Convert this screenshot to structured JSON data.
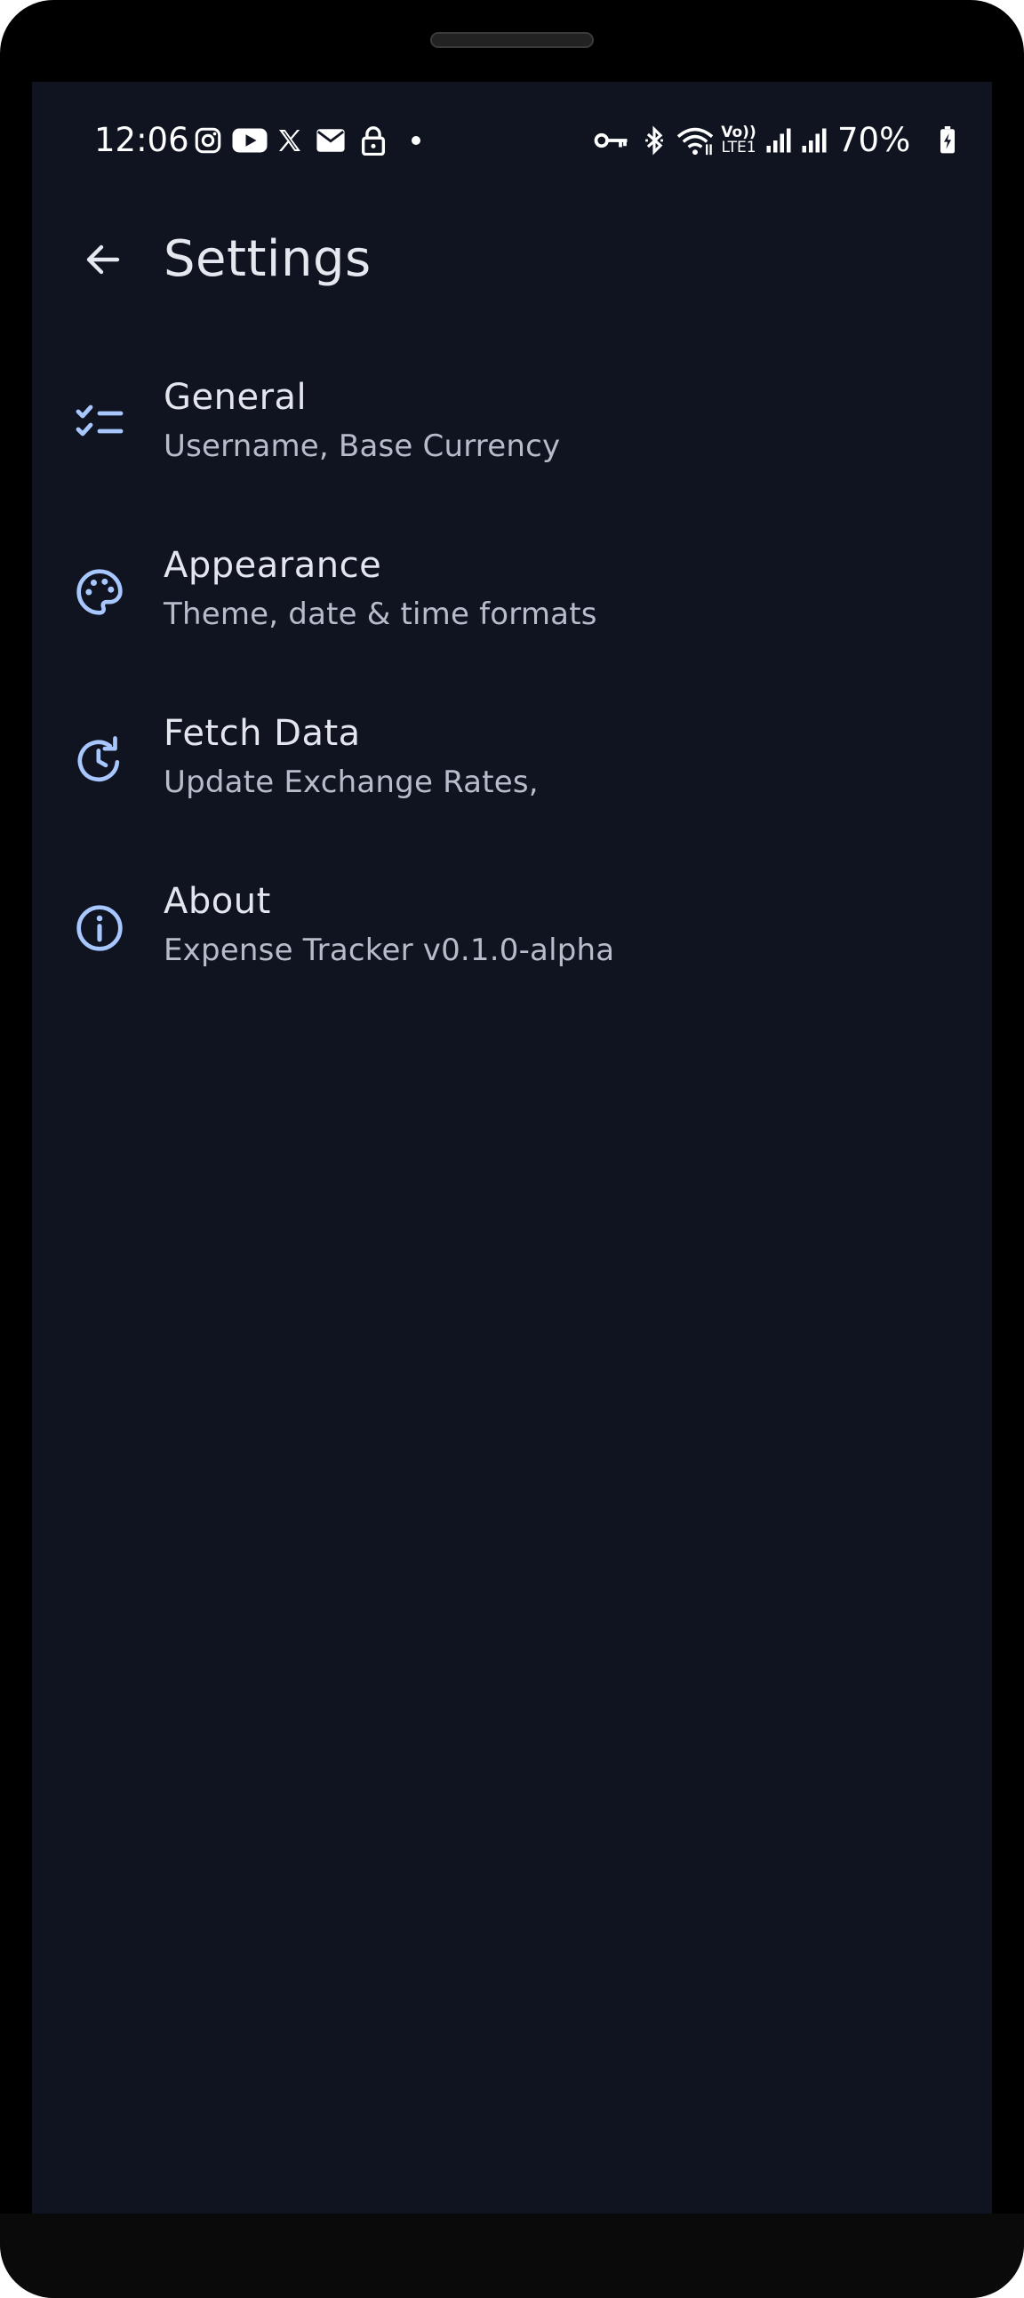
{
  "status_bar": {
    "time": "12:06",
    "notification_icons": [
      "instagram-icon",
      "youtube-icon",
      "x-icon",
      "mail-icon",
      "lock-icon"
    ],
    "system_icons": [
      "vpn-key-icon",
      "bluetooth-icon",
      "wifi-icon",
      "volte-lte1-icon",
      "signal-icon",
      "signal-icon"
    ],
    "volte_label": "Vo))",
    "lte_label": "LTE1",
    "battery_percent": "70%"
  },
  "appbar": {
    "title": "Settings"
  },
  "settings": {
    "items": [
      {
        "title": "General",
        "subtitle": "Username, Base Currency",
        "icon": "checklist-icon"
      },
      {
        "title": "Appearance",
        "subtitle": "Theme, date & time formats",
        "icon": "palette-icon"
      },
      {
        "title": "Fetch Data",
        "subtitle": "Update Exchange Rates,",
        "icon": "update-icon"
      },
      {
        "title": "About",
        "subtitle": "Expense Tracker v0.1.0-alpha",
        "icon": "info-icon"
      }
    ]
  },
  "colors": {
    "background": "#0f1420",
    "accent_icon": "#a9c7ff",
    "title_text": "#e3e6ee",
    "subtitle_text": "#b7bccb"
  }
}
